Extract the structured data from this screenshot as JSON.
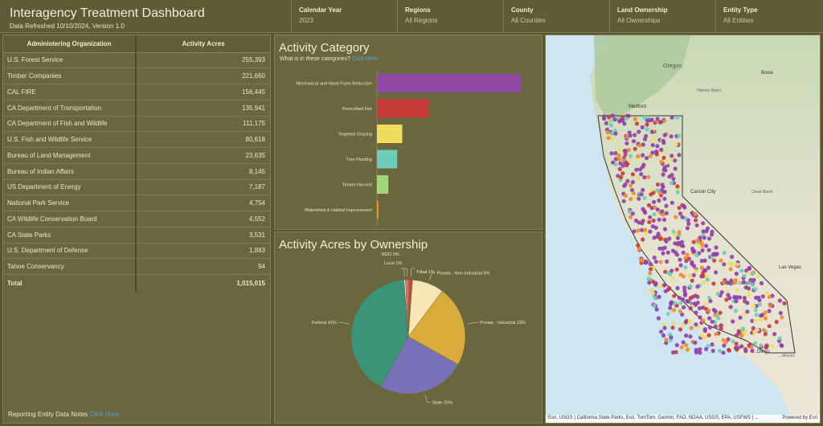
{
  "header": {
    "title": "Interagency Treatment Dashboard",
    "subtitle": "Data Refreshed 10/10/2024, Version 1.0",
    "filters": [
      {
        "label": "Calendar Year",
        "value": "2023"
      },
      {
        "label": "Regions",
        "value": "All Regions"
      },
      {
        "label": "County",
        "value": "All Counties"
      },
      {
        "label": "Land Ownership",
        "value": "All Ownerships"
      },
      {
        "label": "Entity Type",
        "value": "All Entities"
      }
    ]
  },
  "org_table": {
    "col_org": "Administering Organization",
    "col_acres": "Activity Acres",
    "rows": [
      {
        "org": "U.S. Forest Service",
        "acres": "255,393"
      },
      {
        "org": "Timber Companies",
        "acres": "221,660"
      },
      {
        "org": "CAL FIRE",
        "acres": "156,445"
      },
      {
        "org": "CA Department of Transportation",
        "acres": "135,941"
      },
      {
        "org": "CA Department of Fish and Wildlife",
        "acres": "111,175"
      },
      {
        "org": "U.S. Fish and Wildlife Service",
        "acres": "80,618"
      },
      {
        "org": "Bureau of Land Management",
        "acres": "23,635"
      },
      {
        "org": "Bureau of Indian Affairs",
        "acres": "8,145"
      },
      {
        "org": "US Department of Energy",
        "acres": "7,187"
      },
      {
        "org": "National Park Service",
        "acres": "4,754"
      },
      {
        "org": "CA Wildlife Conservation Board",
        "acres": "4,552"
      },
      {
        "org": "CA State Parks",
        "acres": "3,531"
      },
      {
        "org": "U.S. Department of Defense",
        "acres": "1,883"
      },
      {
        "org": "Tahoe Conservancy",
        "acres": "94"
      }
    ],
    "total_label": "Total",
    "total_value": "1,015,015",
    "notes_label": "Reporting Entity Data Notes",
    "notes_link": "Click Here"
  },
  "category_panel": {
    "title": "Activity Category",
    "question": "What is in these categories?",
    "link": "Click Here"
  },
  "ownership_panel": {
    "title": "Activity Acres by Ownership"
  },
  "chart_data": [
    {
      "type": "bar",
      "orientation": "horizontal",
      "title": "Activity Category",
      "categories": [
        "Mechanical and Hand Fuels Reduction",
        "Prescribed Fire",
        "Targeted Grazing",
        "Tree Planting",
        "Timber Harvest",
        "Watershed & Habitat Improvement"
      ],
      "values": [
        570000,
        205000,
        100000,
        80000,
        45000,
        6000
      ],
      "colors": [
        "#8e4aa3",
        "#c73a3a",
        "#f2dc5d",
        "#6dcdb8",
        "#a3d67a",
        "#f08a2c"
      ],
      "xlim": [
        0,
        600000
      ],
      "xticks": [
        0,
        200000,
        400000,
        600000
      ],
      "xtick_labels": [
        "0",
        "200k",
        "400k",
        "600k"
      ]
    },
    {
      "type": "pie",
      "title": "Activity Acres by Ownership",
      "slices": [
        {
          "label": "NGO 0%",
          "value": 0.4,
          "color": "#ffffff"
        },
        {
          "label": "Local 1%",
          "value": 1,
          "color": "#e06b6b"
        },
        {
          "label": "Tribal 1%",
          "value": 1,
          "color": "#c44a3a"
        },
        {
          "label": "Private - Non-Industrial 9%",
          "value": 9,
          "color": "#f7e7b4"
        },
        {
          "label": "Private - Industrial 23%",
          "value": 23,
          "color": "#d9ab3a"
        },
        {
          "label": "State 25%",
          "value": 25,
          "color": "#7a72b8"
        },
        {
          "label": "Federal 41%",
          "value": 41,
          "color": "#3b9478"
        }
      ]
    }
  ],
  "map": {
    "labels": {
      "oregon": "Oregon",
      "boise": "Boise",
      "harney": "Harney Basin",
      "medford": "Medford",
      "carson": "Carson City",
      "great_basin": "Great Basin",
      "las_vegas": "Las Vegas",
      "mojave": "Mojave Desert",
      "diego": "...Diego",
      "mexico": "...Mexico"
    },
    "attribution": "Esri, USGS | California State Parks, Esri, TomTom, Garmin, FAO, NOAA, USGS, EPA, USFWS | ...",
    "powered": "Powered by Esri"
  }
}
